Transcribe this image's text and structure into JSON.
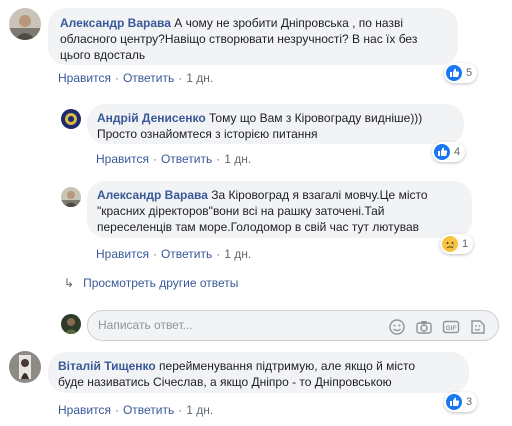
{
  "comments": [
    {
      "author": "Александр Варава",
      "text_lines": [
        "А чому не зробити Дніпровська , по назві",
        "обласного центру?Навіщо створювати незручності? В нас їх без",
        "цього вдосталь"
      ],
      "actions": {
        "like": "Нравится",
        "reply": "Ответить",
        "time": "1 дн."
      },
      "reaction_count": "5",
      "reaction_icon": "like-icon",
      "replies": [
        {
          "author": "Андрій Денисенко",
          "text_lines": [
            "Тому що Вам з Кіровограду видніше)))",
            "Просто ознайомтеся з історією питання"
          ],
          "actions": {
            "like": "Нравится",
            "reply": "Ответить",
            "time": "1 дн."
          },
          "reaction_count": "4",
          "reaction_icon": "like-icon"
        },
        {
          "author": "Александр Варава",
          "text_lines": [
            "За Кіровоград я взагалі мовчу.Це місто",
            "\"красних діректоров\"вони всі на рашку заточені.Тай",
            "переселенців там море.Голодомор в свій час тут лютував"
          ],
          "actions": {
            "like": "Нравится",
            "reply": "Ответить",
            "time": "1 дн."
          },
          "reaction_count": "1",
          "reaction_icon": "sad-icon"
        }
      ],
      "more_replies_label": "Просмотреть другие ответы",
      "reply_input_placeholder": "Написать ответ..."
    },
    {
      "author": "Віталій Тищенко",
      "text_lines": [
        "перейменування підтримую, але якщо й місто",
        "буде називатись Січеслав, а якщо Дніпро - то Дніпровською"
      ],
      "actions": {
        "like": "Нравится",
        "reply": "Ответить",
        "time": "1 дн."
      },
      "reaction_count": "3",
      "reaction_icon": "like-icon"
    }
  ],
  "colors": {
    "author": "#385898",
    "bubble": "#f2f3f5",
    "like_blue": "#1877f2",
    "sad_yellow": "#f7c442"
  },
  "reply_box_icons": [
    "emoji-icon",
    "camera-icon",
    "gif-icon",
    "sticker-icon"
  ]
}
